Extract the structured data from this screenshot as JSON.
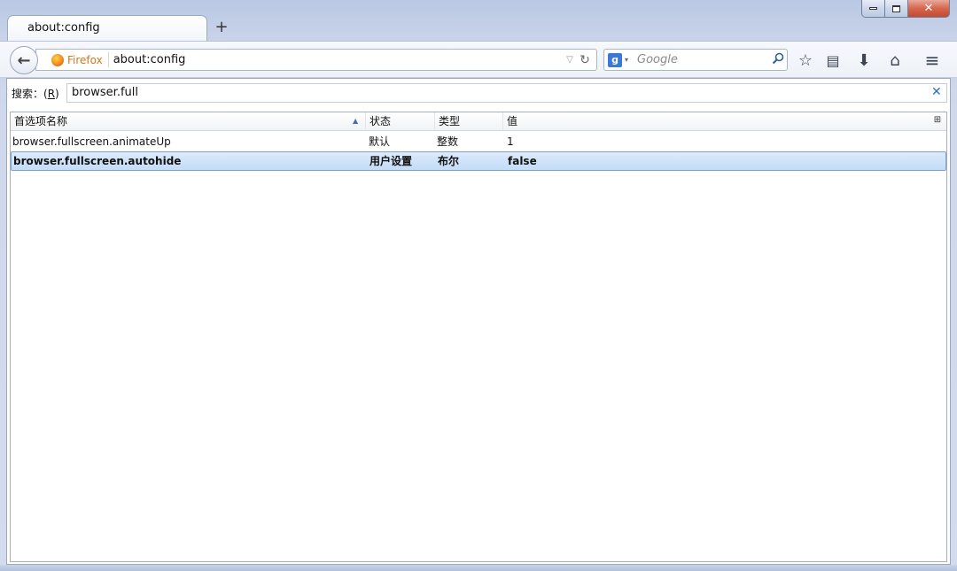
{
  "tab": {
    "title": "about:config",
    "new_tab_label": "+"
  },
  "window_controls": {
    "minimize": "▭",
    "maximize": "▢",
    "close": "✕"
  },
  "navbar": {
    "back_icon": "←",
    "identity_label": "Firefox",
    "url": "about:config",
    "url_dropdown_icon": "▽",
    "reload_icon": "↻",
    "search_engine_letter": "g",
    "search_engine_drop": "▾",
    "search_placeholder": "Google",
    "search_go_icon": "⚲",
    "star_icon": "☆",
    "reading_icon": "▤",
    "download_icon": "⬇",
    "home_icon": "⌂",
    "menu_icon": "≡"
  },
  "filter": {
    "label_prefix": "搜索：(",
    "label_accesskey": "R",
    "label_suffix": ")",
    "value": "browser.full",
    "clear_icon": "✕"
  },
  "columns": {
    "name": "首选项名称",
    "status": "状态",
    "type": "类型",
    "value": "值",
    "sort_icon": "▲",
    "picker_icon": "⊞"
  },
  "rows": [
    {
      "name": "browser.fullscreen.animateUp",
      "status": "默认",
      "type": "整数",
      "value": "1"
    },
    {
      "name": "browser.fullscreen.autohide",
      "status": "用户设置",
      "type": "布尔",
      "value": "false"
    }
  ],
  "colors": {
    "selection_top": "#dceafb",
    "selection_border": "#7da2ce",
    "firefox_label": "#d4761a",
    "close_button": "#c24a2f"
  }
}
